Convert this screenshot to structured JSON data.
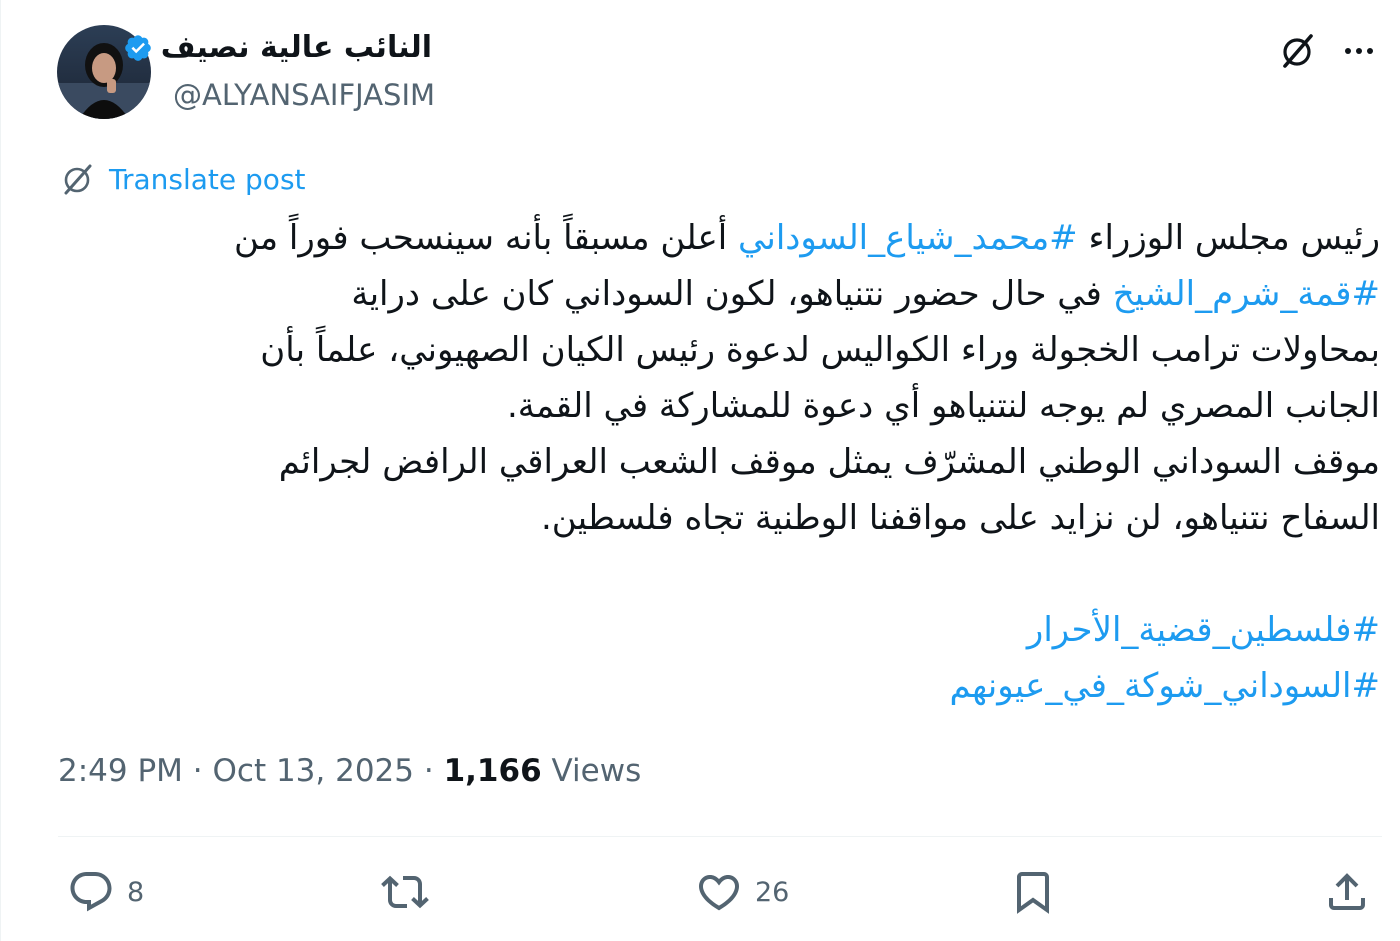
{
  "post": {
    "author": {
      "display_name": "النائب عالية نصيف",
      "handle": "@ALYANSAIFJASIM",
      "verified_icon": "verified-badge-icon"
    },
    "translate_label": "Translate post",
    "text_lines": [
      [
        {
          "t": "رئيس مجلس الوزراء ",
          "h": false
        },
        {
          "t": "#محمد_شياع_السوداني",
          "h": true
        },
        {
          "t": " أعلن مسبقاً بأنه سينسحب فوراً من",
          "h": false
        }
      ],
      [
        {
          "t": "#قمة_شرم_الشيخ",
          "h": true
        },
        {
          "t": " في حال حضور نتنياهو، لكون السوداني كان على دراية",
          "h": false
        }
      ],
      [
        {
          "t": "بمحاولات ترامب الخجولة وراء الكواليس لدعوة رئيس الكيان الصهيوني، علماً بأن",
          "h": false
        }
      ],
      [
        {
          "t": "الجانب المصري لم يوجه لنتنياهو أي دعوة للمشاركة في القمة.",
          "h": false
        }
      ],
      [
        {
          "t": "موقف السوداني الوطني المشرّف يمثل موقف الشعب العراقي الرافض لجرائم",
          "h": false
        }
      ],
      [
        {
          "t": "السفاح نتنياهو، لن نزايد على مواقفنا الوطنية تجاه فلسطين.",
          "h": false
        }
      ],
      [],
      [
        {
          "t": "#فلسطين_قضية_الأحرار",
          "h": true
        }
      ],
      [
        {
          "t": "#السوداني_شوكة_في_عيونهم",
          "h": true
        }
      ]
    ],
    "meta": {
      "time": "2:49 PM",
      "date": "Oct 13, 2025",
      "views_count": "1,166",
      "views_label": "Views"
    },
    "actions": {
      "reply_count": "8",
      "repost_count": "",
      "like_count": "26"
    }
  },
  "colors": {
    "accent": "#1d9bf0",
    "text": "#0f1419",
    "secondary": "#536471"
  }
}
